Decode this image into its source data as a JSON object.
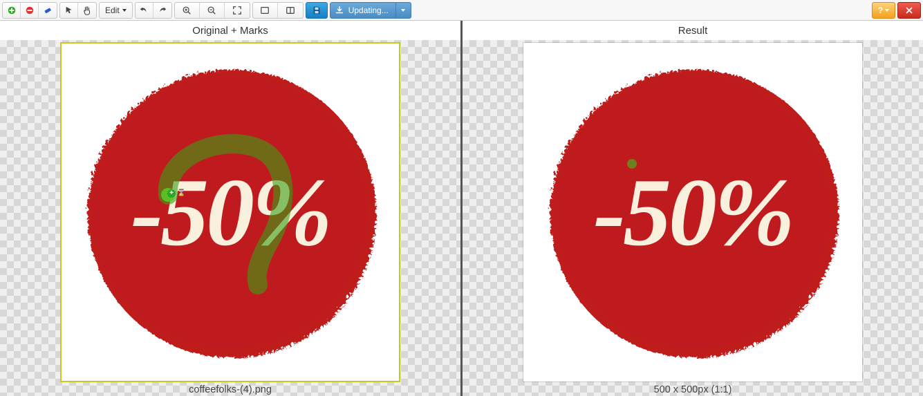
{
  "toolbar": {
    "edit_label": "Edit",
    "update_label": "Updating...",
    "help_label": "?"
  },
  "panes": {
    "left_title": "Original + Marks",
    "right_title": "Result"
  },
  "original": {
    "filename": "coffeefolks-(4).png",
    "discount_text": "-50%"
  },
  "result": {
    "dimensions_text": "500 x 500px (1:1)",
    "discount_text": "-50%"
  }
}
